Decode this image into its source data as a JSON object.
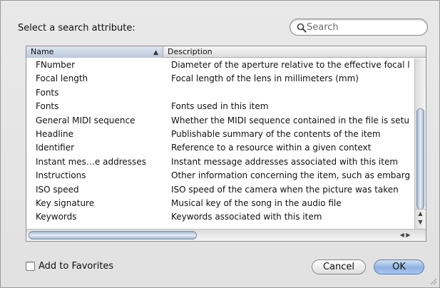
{
  "dialog": {
    "prompt": "Select a search attribute:"
  },
  "search": {
    "placeholder": "Search",
    "value": ""
  },
  "table": {
    "columns": {
      "name": "Name",
      "description": "Description"
    },
    "sort_indicator": "▲",
    "rows": [
      {
        "name": "FNumber",
        "description": "Diameter of the aperture relative to the effective focal l"
      },
      {
        "name": "Focal length",
        "description": "Focal length of the lens in millimeters (mm)"
      },
      {
        "name": "Fonts",
        "description": ""
      },
      {
        "name": "Fonts",
        "description": "Fonts used in this item"
      },
      {
        "name": "General MIDI sequence",
        "description": "Whether the MIDI sequence contained in the file is setu"
      },
      {
        "name": "Headline",
        "description": "Publishable summary of the contents of the item"
      },
      {
        "name": "Identifier",
        "description": "Reference to a resource within a given context"
      },
      {
        "name": "Instant mes…e addresses",
        "description": "Instant message addresses associated with this item"
      },
      {
        "name": "Instructions",
        "description": "Other information concerning the item, such as embarg"
      },
      {
        "name": "ISO speed",
        "description": "ISO speed of the camera when the picture was taken"
      },
      {
        "name": "Key signature",
        "description": "Musical key of the song in the audio file"
      },
      {
        "name": "Keywords",
        "description": "Keywords associated with this item"
      }
    ]
  },
  "footer": {
    "favorites_label": "Add to Favorites",
    "favorites_checked": false,
    "cancel_label": "Cancel",
    "ok_label": "OK"
  },
  "colors": {
    "default_button": "#8fb2e2",
    "header_selected": "#b9c8da"
  }
}
